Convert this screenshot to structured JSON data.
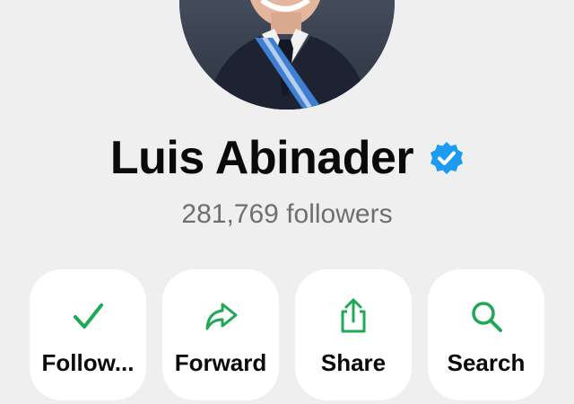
{
  "profile": {
    "name": "Luis Abinader",
    "followers": "281,769 followers",
    "verified": true
  },
  "actions": [
    {
      "label": "Follow...",
      "icon": "checkmark-icon"
    },
    {
      "label": "Forward",
      "icon": "forward-arrow-icon"
    },
    {
      "label": "Share",
      "icon": "share-icon"
    },
    {
      "label": "Search",
      "icon": "search-icon"
    }
  ],
  "colors": {
    "background": "#efefef",
    "card": "#ffffff",
    "accent_green": "#1fa855",
    "verified_blue": "#1d9bf0",
    "name_text": "#0a0a0a",
    "secondary_text": "#6f6f6f"
  }
}
